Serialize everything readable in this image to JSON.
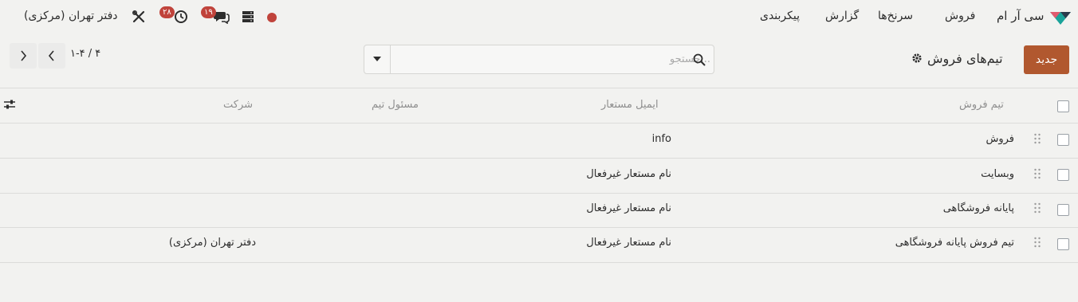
{
  "navbar": {
    "app_name": "سی آر ام",
    "menu": [
      "فروش",
      "سرنخ‌ها",
      "گزارش",
      "پیکربندی"
    ],
    "company": "دفتر تهران (مرکزی)",
    "messages_badge": "۱۹",
    "activities_badge": "۲۸",
    "status_color": "#c0433b"
  },
  "control": {
    "new_label": "جدید",
    "title": "تیم‌های فروش",
    "search_placeholder": "جستجو...",
    "pager": "۱-۴ / ۴"
  },
  "table": {
    "headers": {
      "name": "تیم فروش",
      "alias": "ایمیل مستعار",
      "leader": "مسئول تیم",
      "company": "شرکت"
    },
    "rows": [
      {
        "name": "فروش",
        "alias": "info",
        "leader": "",
        "company": ""
      },
      {
        "name": "وبسایت",
        "alias": "نام مستعار غیرفعال",
        "leader": "",
        "company": ""
      },
      {
        "name": "پایانه فروشگاهی",
        "alias": "نام مستعار غیرفعال",
        "leader": "",
        "company": ""
      },
      {
        "name": "تیم فروش پایانه فروشگاهی",
        "alias": "نام مستعار غیرفعال",
        "leader": "",
        "company": "دفتر تهران (مرکزی)"
      }
    ]
  },
  "colors": {
    "accent": "#b1582f",
    "background": "#f2f2f0",
    "badge": "#c0433b"
  }
}
